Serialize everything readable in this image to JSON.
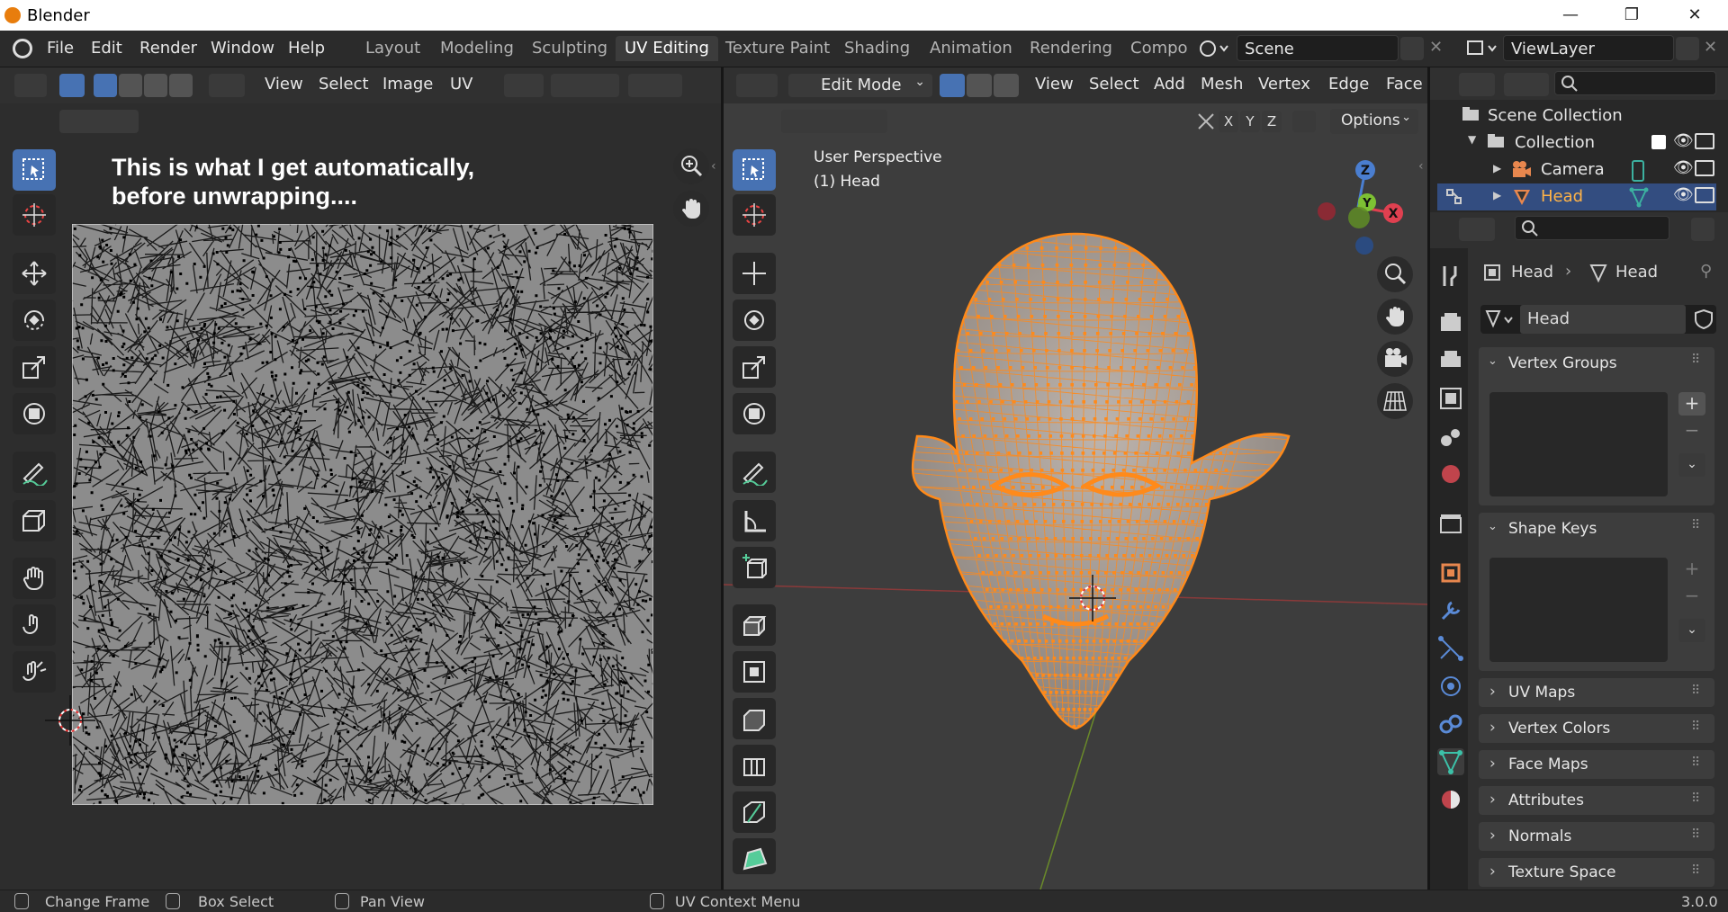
{
  "app": {
    "title": "Blender",
    "version": "3.0.0"
  },
  "menu": [
    "File",
    "Edit",
    "Render",
    "Window",
    "Help"
  ],
  "workspaces": [
    "Layout",
    "Modeling",
    "Sculpting",
    "UV Editing",
    "Texture Paint",
    "Shading",
    "Animation",
    "Rendering",
    "Compo"
  ],
  "active_workspace": "UV Editing",
  "scene": "Scene",
  "view_layer": "ViewLayer",
  "uv_editor": {
    "menu": [
      "View",
      "Select",
      "Image",
      "UV"
    ],
    "overlay_text_line1": "This is what I get automatically,",
    "overlay_text_line2": "before unwrapping...."
  },
  "viewport": {
    "mode": "Edit Mode",
    "menu": [
      "View",
      "Select",
      "Add",
      "Mesh",
      "Vertex",
      "Edge",
      "Face"
    ],
    "axes": [
      "X",
      "Y",
      "Z"
    ],
    "options": "Options",
    "perspective": "User Perspective",
    "object_label": "(1) Head",
    "gizmo": {
      "x": "X",
      "y": "Y",
      "z": "Z"
    }
  },
  "outliner": {
    "root": "Scene Collection",
    "collection": "Collection",
    "items": [
      "Camera",
      "Head"
    ]
  },
  "properties": {
    "breadcrumb_object": "Head",
    "breadcrumb_data": "Head",
    "mesh_name": "Head",
    "sections": [
      "Vertex Groups",
      "Shape Keys",
      "UV Maps",
      "Vertex Colors",
      "Face Maps",
      "Attributes",
      "Normals",
      "Texture Space"
    ]
  },
  "status": {
    "change_frame": "Change Frame",
    "box_select": "Box Select",
    "pan_view": "Pan View",
    "uv_menu": "UV Context Menu"
  },
  "colors": {
    "accent": "#4772b3",
    "selection_orange": "#ff8a1a",
    "header": "#303030",
    "viewport_bg": "#3d3d3d",
    "uv_bg": "#2d2d2d"
  }
}
